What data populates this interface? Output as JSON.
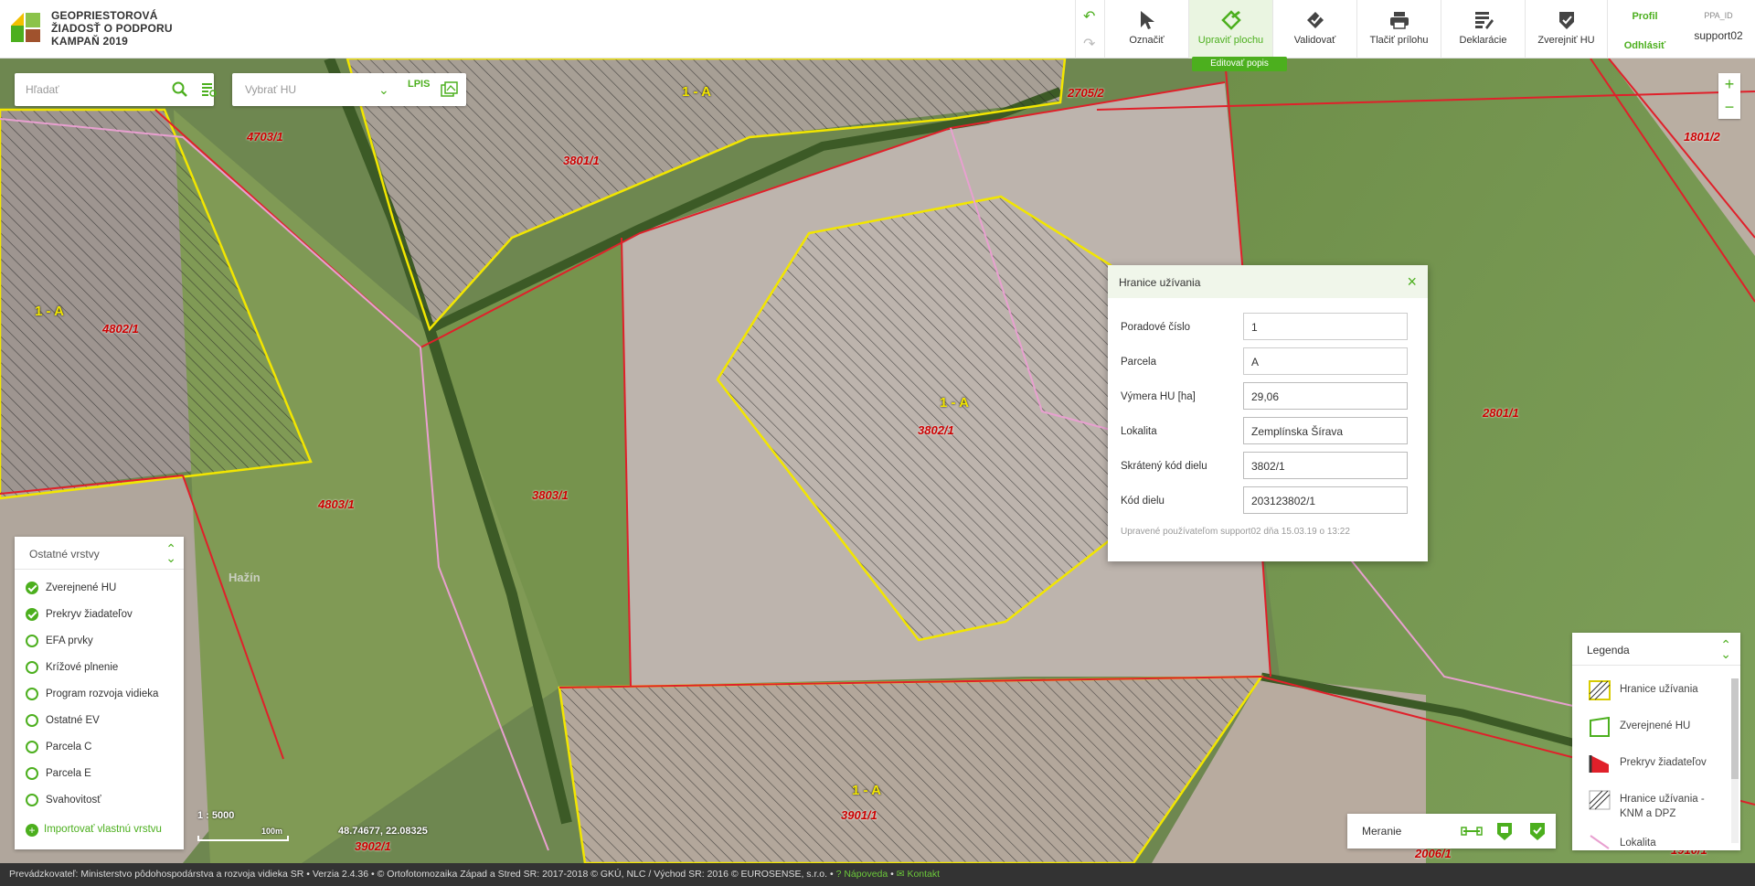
{
  "app": {
    "title_lines": [
      "GEOPRIESTOROVÁ",
      "ŽIADOSŤ O PODPORU",
      "KAMPAŇ 2019"
    ]
  },
  "toolbar": {
    "tools": [
      {
        "label": "Označiť",
        "icon": "cursor-icon"
      },
      {
        "label": "Upraviť plochu",
        "icon": "edit-area-icon"
      },
      {
        "label": "Validovať",
        "icon": "validate-icon"
      },
      {
        "label": "Tlačiť prílohu",
        "icon": "print-icon"
      },
      {
        "label": "Deklarácie",
        "icon": "declarations-icon"
      },
      {
        "label": "Zverejniť HU",
        "icon": "publish-icon"
      }
    ],
    "active_tooltip": "Editovať popis",
    "profile_label": "Profil",
    "logout_label": "Odhlásiť",
    "ppa_id_label": "PPA_ID",
    "username": "support02"
  },
  "search": {
    "placeholder": "Hľadať"
  },
  "hu_select": {
    "placeholder": "Vybrať HU",
    "lpis_label": "LPIS"
  },
  "map": {
    "parcel_labels": [
      "4703/1",
      "3801/1",
      "2705/2",
      "1801/2",
      "4802/1",
      "3802/1",
      "2801/1",
      "4803/1",
      "3803/1",
      "3901/1",
      "3902/1",
      "2006/1",
      "1910/1"
    ],
    "hu_labels": [
      "1 - A",
      "1 - A",
      "1 - A",
      "1 - A"
    ],
    "place_name": "Hažín",
    "scale_label": "1 : 5000",
    "scale_bar_label": "100m",
    "coordinates": "48.74677, 22.08325"
  },
  "popup": {
    "title": "Hranice užívania",
    "fields": [
      {
        "label": "Poradové číslo",
        "value": "1"
      },
      {
        "label": "Parcela",
        "value": "A"
      },
      {
        "label": "Výmera HU [ha]",
        "value": "29,06"
      },
      {
        "label": "Lokalita",
        "value": "Zemplínska Šírava"
      },
      {
        "label": "Skrátený kód dielu",
        "value": "3802/1"
      },
      {
        "label": "Kód dielu",
        "value": "203123802/1"
      }
    ],
    "footer": "Upravené používateľom support02 dňa 15.03.19 o 13:22"
  },
  "layers": {
    "title": "Ostatné vrstvy",
    "items": [
      {
        "label": "Zverejnené HU",
        "checked": true
      },
      {
        "label": "Prekryv žiadateľov",
        "checked": true
      },
      {
        "label": "EFA prvky",
        "checked": false
      },
      {
        "label": "Krížové plnenie",
        "checked": false
      },
      {
        "label": "Program rozvoja vidieka",
        "checked": false
      },
      {
        "label": "Ostatné EV",
        "checked": false
      },
      {
        "label": "Parcela C",
        "checked": false
      },
      {
        "label": "Parcela E",
        "checked": false
      },
      {
        "label": "Svahovitosť",
        "checked": false
      }
    ],
    "import_label": "Importovať vlastnú vrstvu"
  },
  "legend": {
    "title": "Legenda",
    "items": [
      {
        "label": "Hranice užívania"
      },
      {
        "label": "Zverejnené HU"
      },
      {
        "label": "Prekryv žiadateľov"
      },
      {
        "label": "Hranice užívania - KNM a DPZ"
      },
      {
        "label": "Lokalita"
      }
    ]
  },
  "measure": {
    "label": "Meranie"
  },
  "footer": {
    "text": "Prevádzkovateľ: Ministerstvo pôdohospodárstva a rozvoja vidieka SR • Verzia 2.4.36 • © Ortofotomozaika Západ a Stred SR: 2017-2018 © GKÚ, NLC / Východ SR: 2016 © EUROSENSE, s.r.o.  •",
    "help": "Nápoveda",
    "contact": "Kontakt"
  },
  "colors": {
    "accent": "#4caf1e",
    "hu_boundary": "#f2e600",
    "parcel_boundary": "#e0202a",
    "locality": "#e8a0d0"
  }
}
